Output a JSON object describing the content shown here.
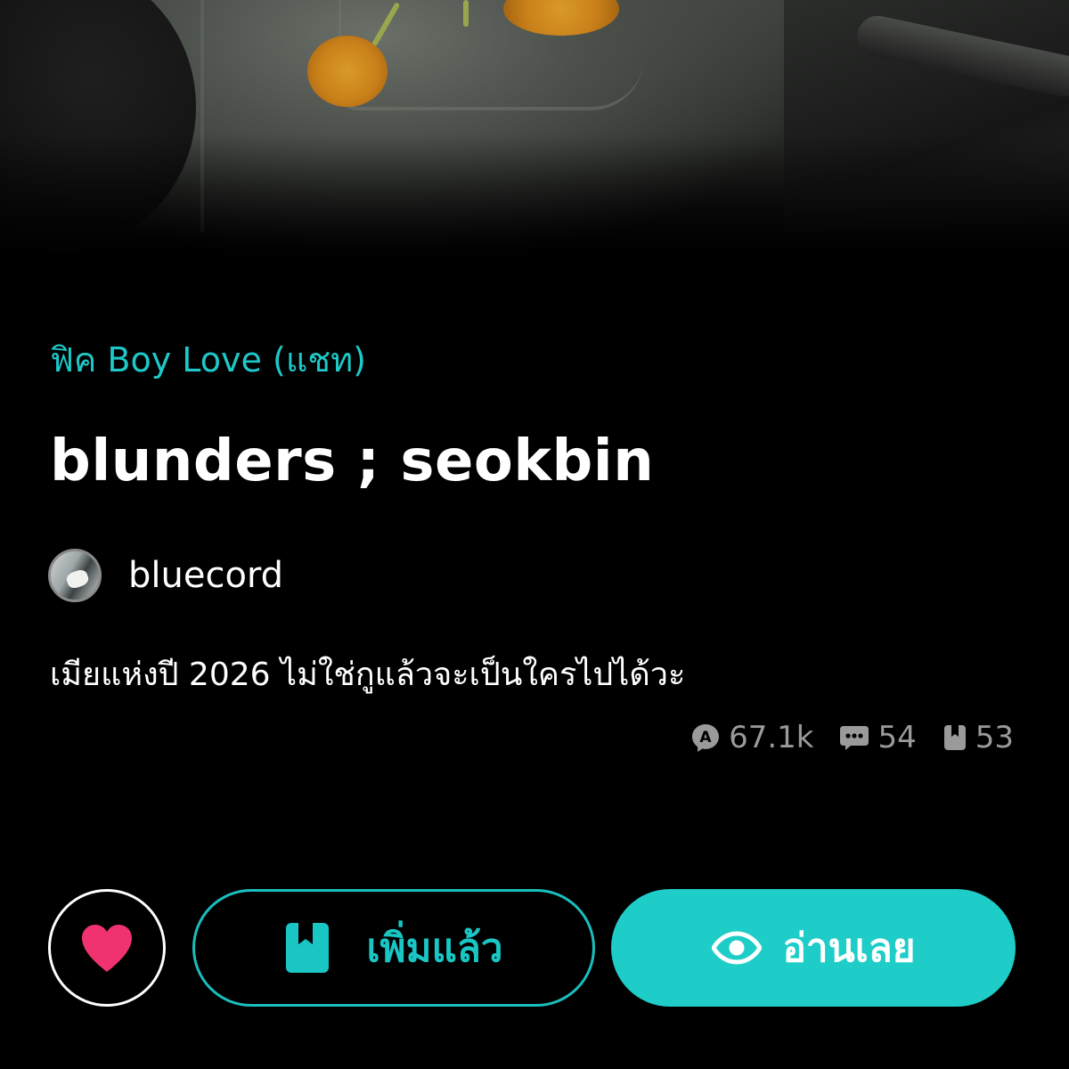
{
  "story": {
    "category": "ฟิค Boy Love (แชท)",
    "title": "blunders ; seokbin",
    "author": "bluecord",
    "synopsis": "เมียแห่งปี 2026 ไม่ใช่กูแล้วจะเป็นใครไปได้วะ"
  },
  "stats": {
    "views": "67.1k",
    "comments": "54",
    "bookmarks": "53",
    "icons": [
      "reads-icon",
      "comments-icon",
      "bookmark-icon"
    ]
  },
  "actions": {
    "like_icon": "heart-icon",
    "added_label": "เพิ่มแล้ว",
    "read_label": "อ่านเลย"
  },
  "colors": {
    "accent": "#1ecdc8",
    "heart": "#f0336e",
    "background": "#000000",
    "muted": "#9a9a9a"
  }
}
